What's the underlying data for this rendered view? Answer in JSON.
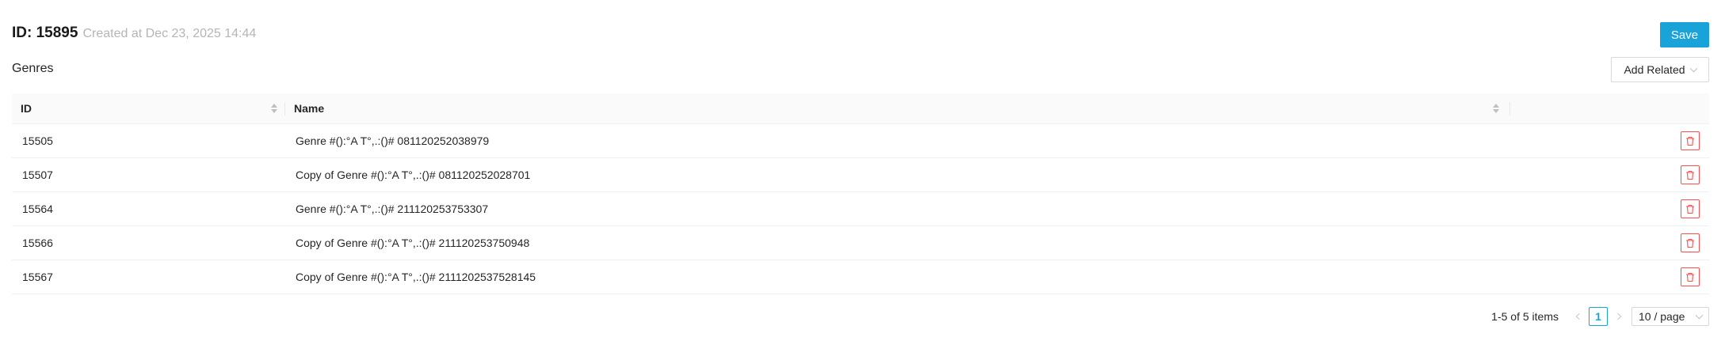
{
  "header": {
    "id_label": "ID: 15895",
    "created_text": "Created at Dec 23, 2025 14:44",
    "save_label": "Save"
  },
  "section": {
    "title": "Genres",
    "add_related_label": "Add Related"
  },
  "table": {
    "columns": [
      "ID",
      "Name"
    ],
    "rows": [
      {
        "id": "15505",
        "name": "Genre #():°A T°,.:()# 081120252038979"
      },
      {
        "id": "15507",
        "name": "Copy of Genre #():°A T°,.:()# 081120252028701"
      },
      {
        "id": "15564",
        "name": "Genre #():°A T°,.:()# 211120253753307"
      },
      {
        "id": "15566",
        "name": "Copy of Genre #():°A T°,.:()# 211120253750948"
      },
      {
        "id": "15567",
        "name": "Copy of Genre #():°A T°,.:()# 2111202537528145"
      }
    ]
  },
  "pagination": {
    "total_text": "1-5 of 5 items",
    "current_page": "1",
    "page_size": "10 / page"
  },
  "colors": {
    "primary": "#1aa3d9",
    "danger": "#ff4d4f",
    "muted": "#b5b5b5"
  },
  "icons": {
    "sort": "sort-icon",
    "delete": "trash-icon",
    "dropdown": "chevron-down-icon"
  }
}
